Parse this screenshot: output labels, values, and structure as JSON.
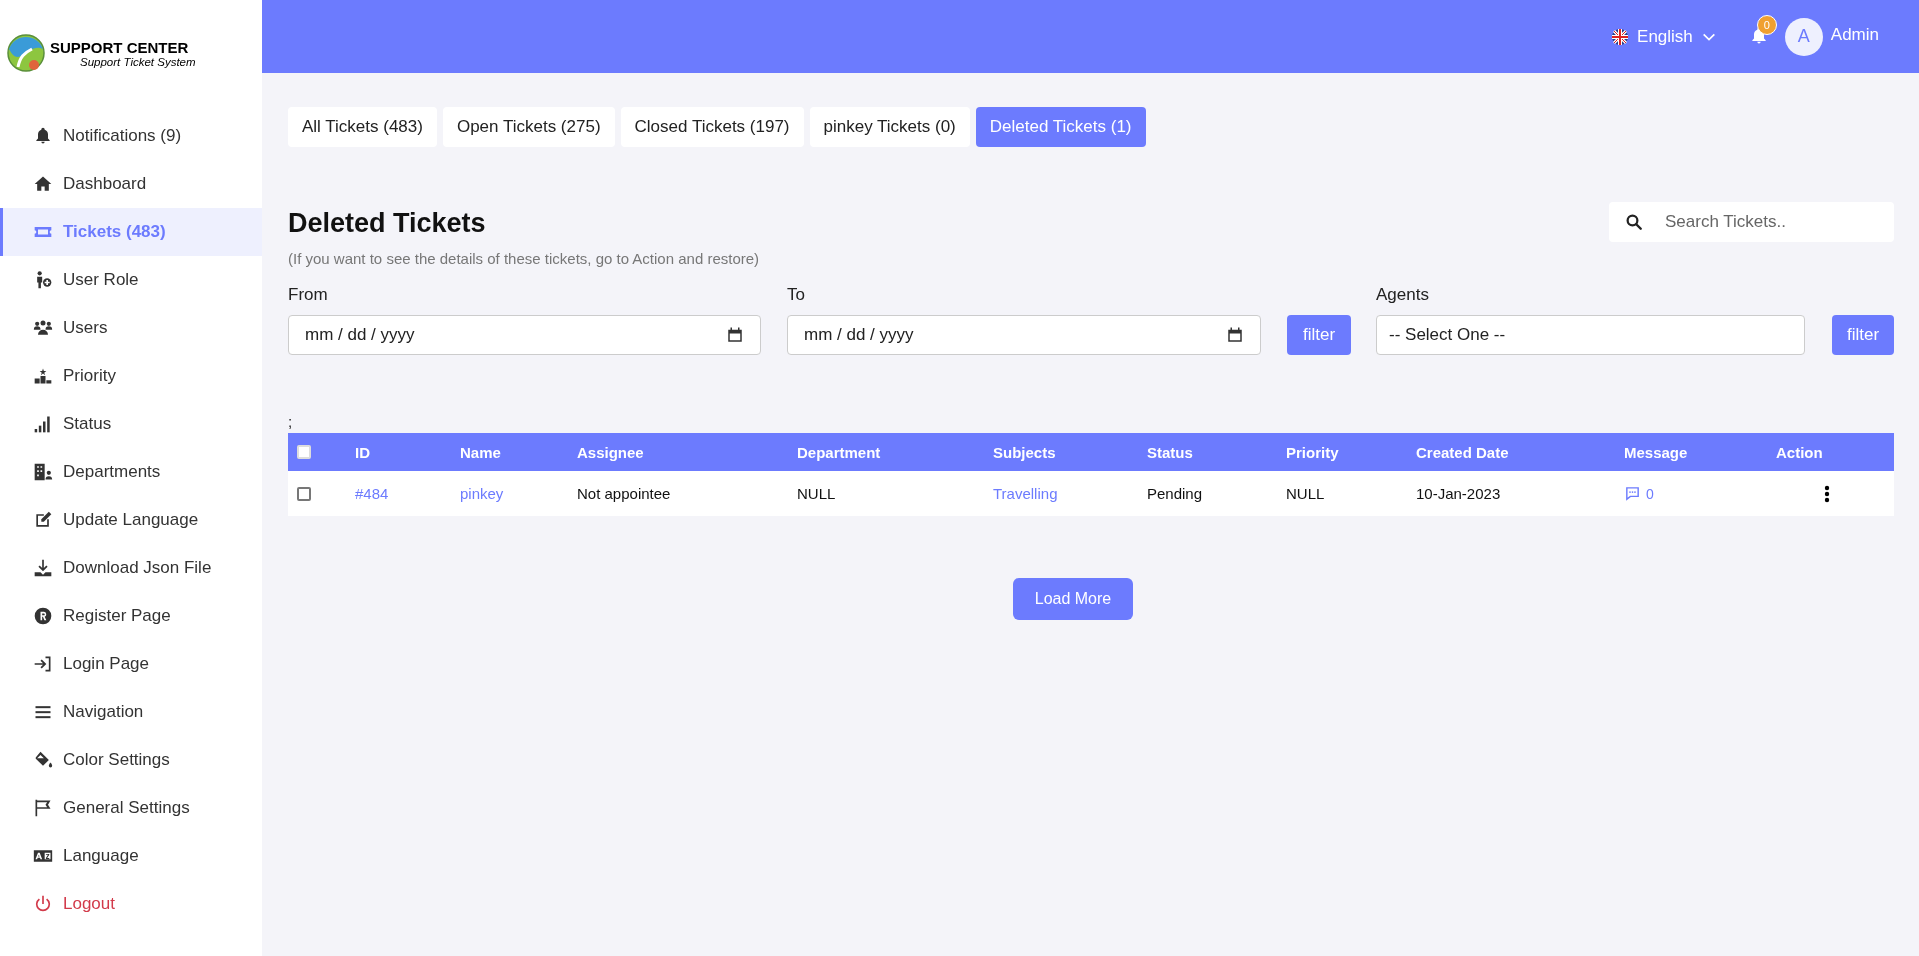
{
  "brand": {
    "title": "SUPPORT CENTER",
    "subtitle": "Support Ticket System"
  },
  "header": {
    "language": "English",
    "notification_count": "0",
    "avatar_letter": "A",
    "user": "Admin"
  },
  "sidebar": {
    "items": [
      {
        "label": "Notifications (9)",
        "selected": false,
        "kind": "normal"
      },
      {
        "label": "Dashboard",
        "selected": false,
        "kind": "normal"
      },
      {
        "label": "Tickets (483)",
        "selected": true,
        "kind": "normal"
      },
      {
        "label": "User Role",
        "selected": false,
        "kind": "normal"
      },
      {
        "label": "Users",
        "selected": false,
        "kind": "normal"
      },
      {
        "label": "Priority",
        "selected": false,
        "kind": "normal"
      },
      {
        "label": "Status",
        "selected": false,
        "kind": "normal"
      },
      {
        "label": "Departments",
        "selected": false,
        "kind": "normal"
      },
      {
        "label": "Update Language",
        "selected": false,
        "kind": "normal"
      },
      {
        "label": "Download Json File",
        "selected": false,
        "kind": "normal"
      },
      {
        "label": "Register Page",
        "selected": false,
        "kind": "normal"
      },
      {
        "label": "Login Page",
        "selected": false,
        "kind": "normal"
      },
      {
        "label": "Navigation",
        "selected": false,
        "kind": "normal"
      },
      {
        "label": "Color Settings",
        "selected": false,
        "kind": "normal"
      },
      {
        "label": "General Settings",
        "selected": false,
        "kind": "normal"
      },
      {
        "label": "Language",
        "selected": false,
        "kind": "normal"
      },
      {
        "label": "Logout",
        "selected": false,
        "kind": "danger"
      }
    ]
  },
  "tabs": [
    {
      "label": "All Tickets (483)",
      "selected": false
    },
    {
      "label": "Open Tickets (275)",
      "selected": false
    },
    {
      "label": "Closed Tickets (197)",
      "selected": false
    },
    {
      "label": "pinkey Tickets (0)",
      "selected": false
    },
    {
      "label": "Deleted Tickets (1)",
      "selected": true
    }
  ],
  "page": {
    "title": "Deleted Tickets",
    "note": "(If you want to see the details of these tickets, go to Action and restore)",
    "search": {
      "placeholder": "Search Tickets.."
    }
  },
  "filters": {
    "from": {
      "label": "From",
      "placeholder": "mm / dd / yyyy"
    },
    "to": {
      "label": "To",
      "placeholder": "mm / dd / yyyy"
    },
    "date_button": "filter",
    "agents": {
      "label": "Agents",
      "value": "-- Select One --"
    },
    "agent_button": "filter"
  },
  "stray_text": ";",
  "table": {
    "select_all_checked": false,
    "columns": [
      "ID",
      "Name",
      "Assignee",
      "Department",
      "Subjects",
      "Status",
      "Priority",
      "Created Date",
      "Message",
      "Action"
    ],
    "rows": [
      {
        "checked": false,
        "id": "#484",
        "name": "pinkey",
        "assignee": "Not appointee",
        "department": "NULL",
        "subject": "Travelling",
        "status": "Pending",
        "priority": "NULL",
        "created": "10-Jan-2023",
        "messages": "0"
      }
    ]
  },
  "load_more": "Load More"
}
